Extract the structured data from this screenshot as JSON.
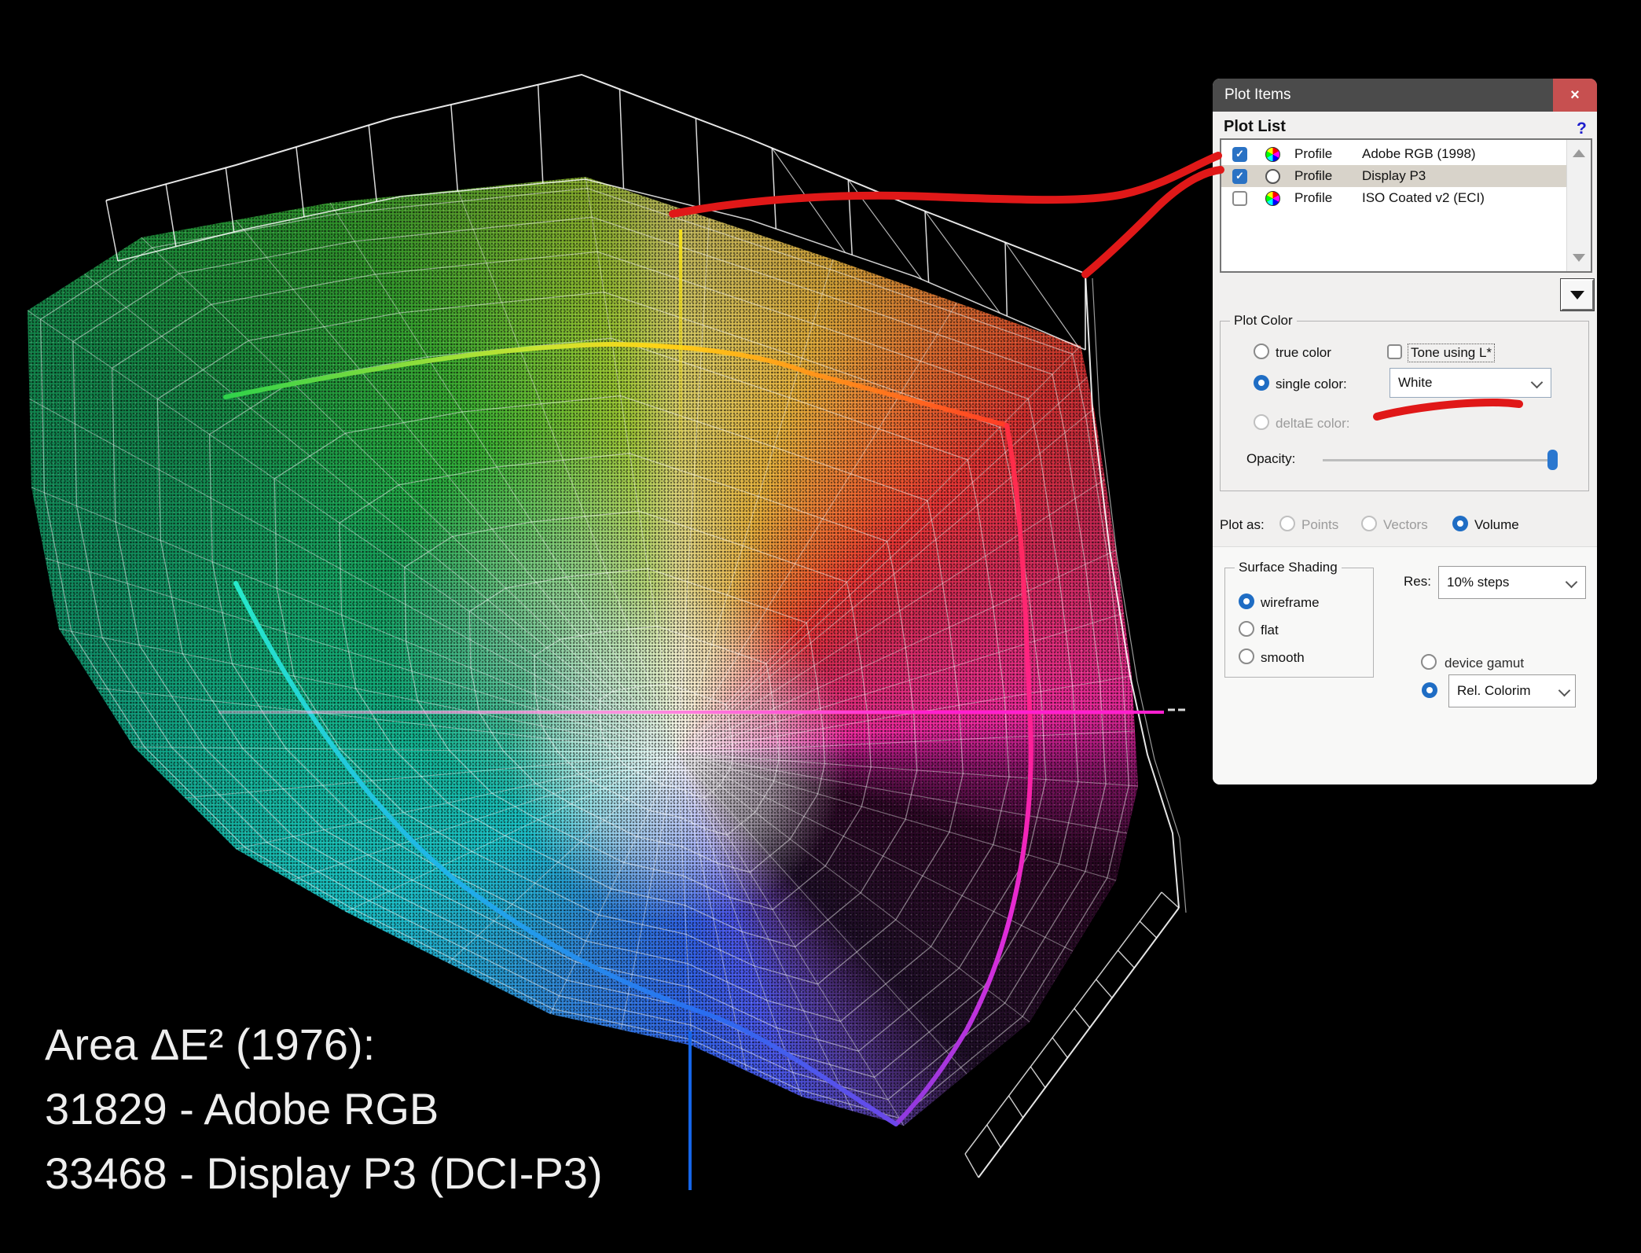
{
  "annotation": {
    "area_title": "Area ΔE² (1976):",
    "area_line1": "31829 - Adobe RGB",
    "area_line2": "33468 - Display P3 (DCI-P3)"
  },
  "gamut_plot": {
    "description": "3D Lab gamut comparison: colored dotted volume vs white wireframe volume",
    "profiles_plotted": [
      "Adobe RGB (1998)",
      "Display P3"
    ],
    "wireframe_color": "#ffffff",
    "annotation_color": "#e01818"
  },
  "dialog": {
    "title": "Plot Items",
    "close_label": "×",
    "plot_list": {
      "header": "Plot List",
      "help": "?",
      "rows": [
        {
          "checked": true,
          "icon": "color-wheel-icon",
          "type": "Profile",
          "name": "Adobe RGB (1998)",
          "selected": false
        },
        {
          "checked": true,
          "icon": "circle-outline-icon",
          "type": "Profile",
          "name": "Display P3",
          "selected": true
        },
        {
          "checked": false,
          "icon": "color-wheel-icon",
          "type": "Profile",
          "name": "ISO Coated v2 (ECI)",
          "selected": false
        }
      ]
    },
    "plot_color": {
      "group_label": "Plot Color",
      "true_color_label": "true color",
      "tone_label": "Tone using L*",
      "single_color_label": "single color:",
      "single_color_value": "White",
      "deltae_label": "deltaE color:",
      "opacity_label": "Opacity:",
      "opacity_value_pct": 100
    },
    "plot_as": {
      "label": "Plot as:",
      "options": [
        "Points",
        "Vectors",
        "Volume"
      ],
      "selected": "Volume"
    },
    "surface_shading": {
      "group_label": "Surface Shading",
      "options": [
        "wireframe",
        "flat",
        "smooth"
      ],
      "selected": "wireframe"
    },
    "res": {
      "label": "Res:",
      "value": "10% steps"
    },
    "gamut_options": {
      "device_label": "device gamut",
      "intent_value": "Rel. Colorim"
    }
  },
  "colors": {
    "titlebar": "#4b4b4b",
    "close_button": "#c75050",
    "accent_blue": "#2a72c4",
    "selection_row": "#d8d3ca",
    "annotation_red": "#e01818"
  }
}
